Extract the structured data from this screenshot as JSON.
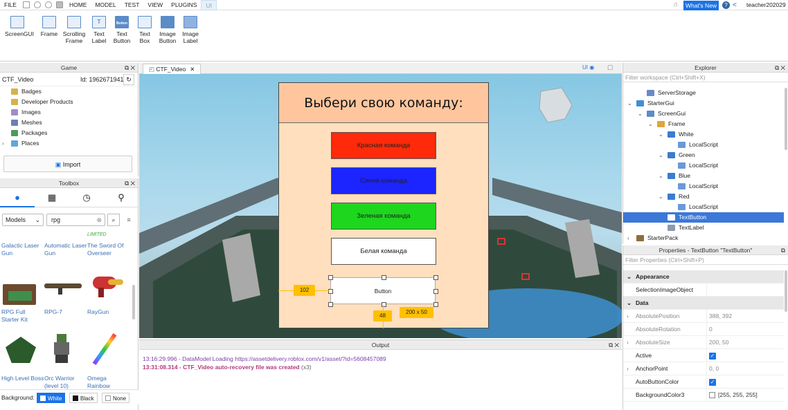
{
  "menubar": {
    "file": "FILE",
    "tabs": [
      "HOME",
      "MODEL",
      "TEST",
      "VIEW",
      "PLUGINS",
      "UI"
    ],
    "whats_new": "What's New",
    "user": "teacher202029"
  },
  "ribbon": {
    "items": [
      {
        "label": "ScreenGUI",
        "icon": "screengui-icon"
      },
      {
        "label": "Frame",
        "icon": "frame-icon"
      },
      {
        "label": "Scrolling\nFrame",
        "icon": "scrolling-frame-icon"
      },
      {
        "label": "Text\nLabel",
        "icon": "text-label-icon",
        "glyph": "T"
      },
      {
        "label": "Text\nButton",
        "icon": "text-button-icon",
        "glyph": "Button"
      },
      {
        "label": "Text\nBox",
        "icon": "text-box-icon"
      },
      {
        "label": "Image\nButton",
        "icon": "image-button-icon"
      },
      {
        "label": "Image\nLabel",
        "icon": "image-label-icon"
      }
    ]
  },
  "game": {
    "title": "Game",
    "place": "CTF_Video",
    "id": "Id: 1962671941",
    "items": [
      "Badges",
      "Developer Products",
      "Images",
      "Meshes",
      "Packages",
      "Places"
    ],
    "import": "Import"
  },
  "toolbox": {
    "title": "Toolbox",
    "category": "Models",
    "search": "rpg",
    "items": [
      {
        "name": "Galactic Laser Gun"
      },
      {
        "name": "Automatic Laser Gun"
      },
      {
        "name": "The Sword Of Overseer",
        "badge": "LIMITED"
      },
      {
        "name": "RPG Full Starter Kit"
      },
      {
        "name": "RPG-7"
      },
      {
        "name": "RayGun"
      },
      {
        "name": "High Level Boss"
      },
      {
        "name": "Orc Warrior (level 10)"
      },
      {
        "name": "Omega Rainbow"
      }
    ],
    "background_label": "Background:",
    "bg_options": [
      "White",
      "Black",
      "None"
    ]
  },
  "viewport": {
    "tab": "CTF_Video",
    "ui_toggle": "UI",
    "frame_title": "Выбери свою команду:",
    "buttons": [
      {
        "label": "Красная команда",
        "color": "#ff2a0a"
      },
      {
        "label": "Синяя команда",
        "color": "#1c24ff"
      },
      {
        "label": "Зеленая команда",
        "color": "#1dd61d"
      },
      {
        "label": "Белая команда",
        "color": "#ffffff"
      }
    ],
    "selected_button": "Button",
    "badge_left": "102",
    "badge_top": "48",
    "badge_size": "200 x 50"
  },
  "output": {
    "title": "Output",
    "lines": [
      {
        "text": "13:16:29.996 - DataModel Loading https://assetdelivery.roblox.com/v1/asset/?id=5608457089",
        "color": "#7b3fa8"
      },
      {
        "text": "13:31:08.314 - CTF_Video auto-recovery file was created",
        "color": "#b03a7a",
        "suffix": " (x3)"
      }
    ]
  },
  "explorer": {
    "title": "Explorer",
    "filter": "Filter workspace (Ctrl+Shift+X)",
    "rows": [
      {
        "label": "ServerStorage",
        "depth": 1,
        "arrow": ""
      },
      {
        "label": "StarterGui",
        "depth": 0,
        "arrow": "v"
      },
      {
        "label": "ScreenGui",
        "depth": 1,
        "arrow": "v"
      },
      {
        "label": "Frame",
        "depth": 2,
        "arrow": "v"
      },
      {
        "label": "White",
        "depth": 3,
        "arrow": "v"
      },
      {
        "label": "LocalScript",
        "depth": 4,
        "arrow": ""
      },
      {
        "label": "Green",
        "depth": 3,
        "arrow": "v"
      },
      {
        "label": "LocalScript",
        "depth": 4,
        "arrow": ""
      },
      {
        "label": "Blue",
        "depth": 3,
        "arrow": "v"
      },
      {
        "label": "LocalScript",
        "depth": 4,
        "arrow": ""
      },
      {
        "label": "Red",
        "depth": 3,
        "arrow": "v"
      },
      {
        "label": "LocalScript",
        "depth": 4,
        "arrow": ""
      },
      {
        "label": "TextButton",
        "depth": 3,
        "arrow": "",
        "selected": true
      },
      {
        "label": "TextLabel",
        "depth": 3,
        "arrow": ""
      },
      {
        "label": "StarterPack",
        "depth": 0,
        "arrow": ">"
      }
    ]
  },
  "properties": {
    "title": "Properties - TextButton \"TextButton\"",
    "filter": "Filter Properties (Ctrl+Shift+P)",
    "rows": [
      {
        "name": "Appearance",
        "section": true
      },
      {
        "name": "SelectionImageObject",
        "value": ""
      },
      {
        "name": "Data",
        "section": true
      },
      {
        "name": "AbsolutePosition",
        "value": "388, 392",
        "grey": true
      },
      {
        "name": "AbsoluteRotation",
        "value": "0",
        "grey": true
      },
      {
        "name": "AbsoluteSize",
        "value": "200, 50",
        "grey": true
      },
      {
        "name": "Active",
        "check": true
      },
      {
        "name": "AnchorPoint",
        "value": "0, 0"
      },
      {
        "name": "AutoButtonColor",
        "check": true
      },
      {
        "name": "BackgroundColor3",
        "value": "[255, 255, 255]",
        "swatch": "#ffffff"
      }
    ]
  }
}
